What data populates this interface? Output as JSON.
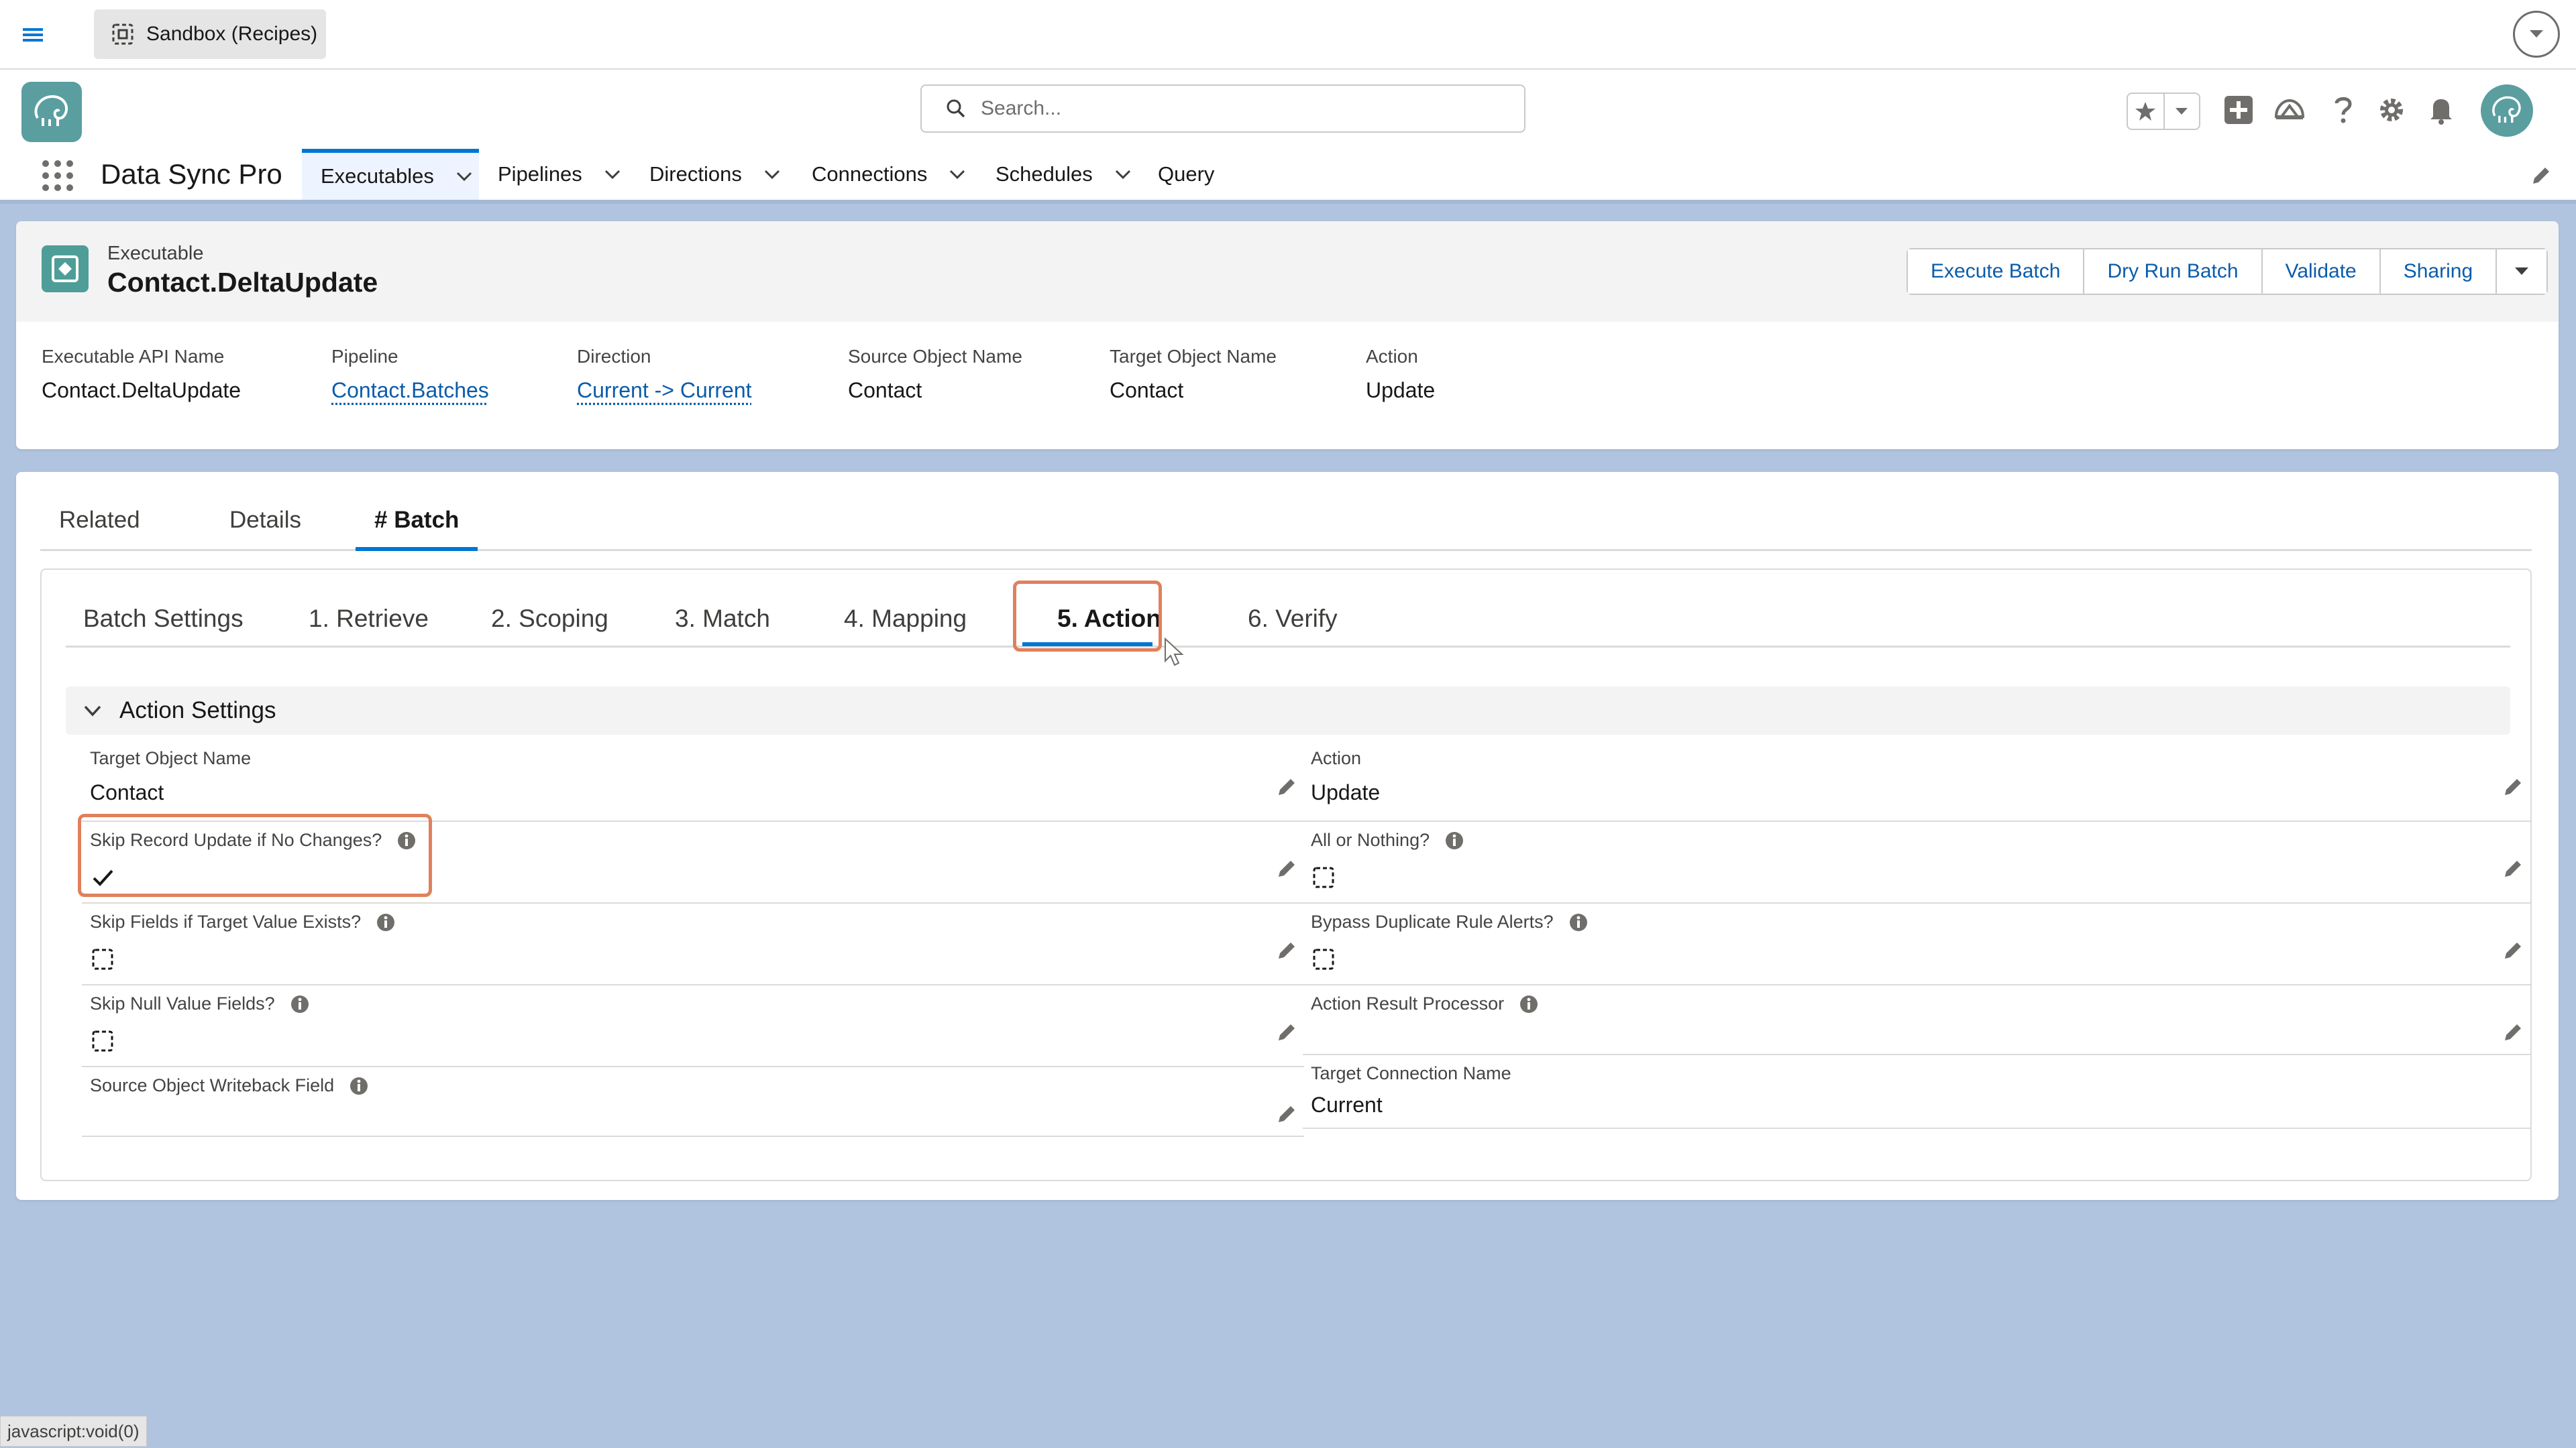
{
  "top_bar": {
    "org_label": "Sandbox (Recipes)"
  },
  "header": {
    "search_placeholder": "Search..."
  },
  "nav": {
    "app_name": "Data Sync Pro",
    "items": [
      {
        "label": "Executables",
        "active": true
      },
      {
        "label": "Pipelines"
      },
      {
        "label": "Directions"
      },
      {
        "label": "Connections"
      },
      {
        "label": "Schedules"
      },
      {
        "label": "Query"
      }
    ]
  },
  "record": {
    "type_label": "Executable",
    "title": "Contact.DeltaUpdate",
    "actions": [
      "Execute Batch",
      "Dry Run Batch",
      "Validate",
      "Sharing"
    ],
    "fields": [
      {
        "label": "Executable API Name",
        "value": "Contact.DeltaUpdate"
      },
      {
        "label": "Pipeline",
        "value": "Contact.Batches"
      },
      {
        "label": "Direction",
        "value": "Current -> Current"
      },
      {
        "label": "Source Object Name",
        "value": "Contact"
      },
      {
        "label": "Target Object Name",
        "value": "Contact"
      },
      {
        "label": "Action",
        "value": "Update"
      }
    ]
  },
  "tabs": [
    "Related",
    "Details",
    "# Batch"
  ],
  "active_tab": "# Batch",
  "subtabs": [
    "Batch Settings",
    "1. Retrieve",
    "2. Scoping",
    "3. Match",
    "4. Mapping",
    "5. Action",
    "6. Verify"
  ],
  "active_subtab": "5. Action",
  "section": {
    "title": "Action Settings",
    "left_fields": [
      {
        "label": "Target Object Name",
        "value": "Contact"
      },
      {
        "label": "Skip Record Update if No Changes?",
        "checked": true
      },
      {
        "label": "Skip Fields if Target Value Exists?",
        "checked": false
      },
      {
        "label": "Skip Null Value Fields?",
        "checked": false
      },
      {
        "label": "Source Object Writeback Field",
        "value": ""
      }
    ],
    "right_fields": [
      {
        "label": "Action",
        "value": "Update"
      },
      {
        "label": "All or Nothing?",
        "checked": false
      },
      {
        "label": "Bypass Duplicate Rule Alerts?",
        "checked": false
      },
      {
        "label": "Action Result Processor",
        "value": ""
      },
      {
        "label": "Target Connection Name",
        "value": "Current"
      }
    ]
  },
  "status_bar": "javascript:void(0)",
  "colors": {
    "brand_blue": "#0176d3",
    "link_blue": "#0b5cab",
    "highlight_orange": "#e0805c",
    "page_background": "#b0c4df",
    "app_teal": "#5a9ea0"
  }
}
